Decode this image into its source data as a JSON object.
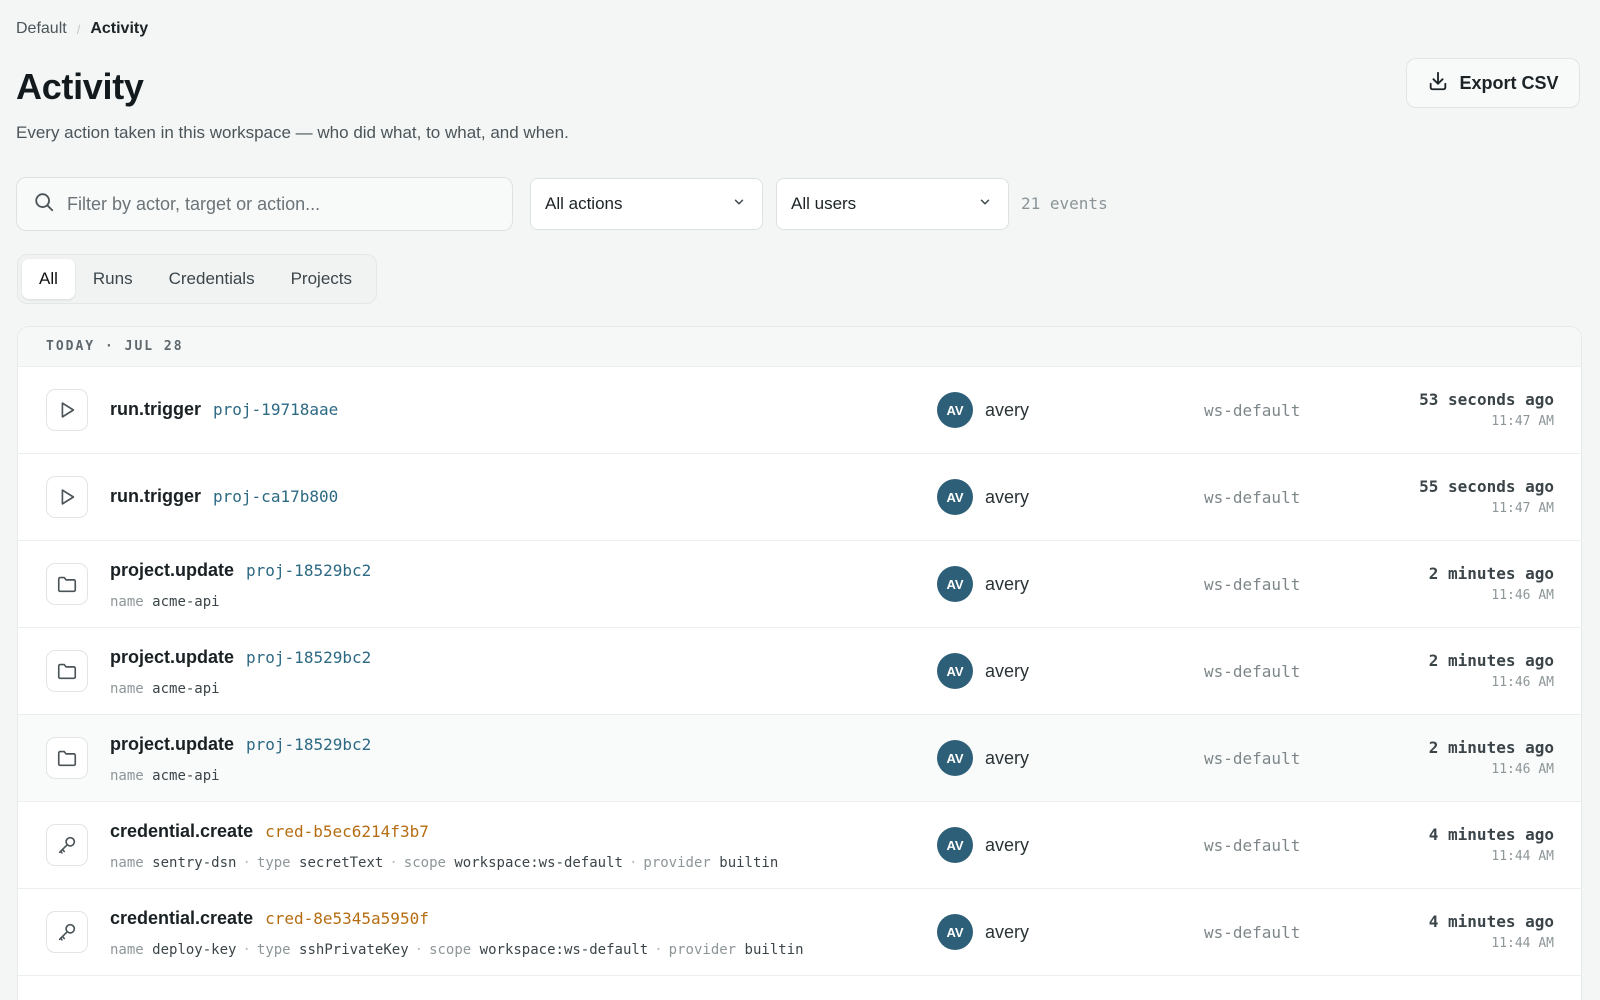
{
  "breadcrumb": {
    "parent": "Default",
    "separator": "/",
    "current": "Activity"
  },
  "page": {
    "title": "Activity",
    "subtitle": "Every action taken in this workspace — who did what, to what, and when."
  },
  "toolbar": {
    "export_label": "Export CSV"
  },
  "filters": {
    "search_placeholder": "Filter by actor, target or action...",
    "search_value": "",
    "action_select": "All actions",
    "user_select": "All users",
    "events_count": "21 events"
  },
  "tabs": [
    {
      "label": "All",
      "active": true
    },
    {
      "label": "Runs",
      "active": false
    },
    {
      "label": "Credentials",
      "active": false
    },
    {
      "label": "Projects",
      "active": false
    }
  ],
  "group": {
    "label": "TODAY · JUL 28"
  },
  "colors": {
    "avatar": "#2e5f78",
    "project_target": "#2c6983",
    "credential_target": "#b66d12"
  },
  "rows": [
    {
      "icon": "play-icon",
      "action": "run.trigger",
      "target": "proj-19718aae",
      "target_kind": "project",
      "meta": [],
      "actor_initials": "AV",
      "actor": "avery",
      "workspace": "ws-default",
      "relative_time": "53 seconds ago",
      "time": "11:47 AM"
    },
    {
      "icon": "play-icon",
      "action": "run.trigger",
      "target": "proj-ca17b800",
      "target_kind": "project",
      "meta": [],
      "actor_initials": "AV",
      "actor": "avery",
      "workspace": "ws-default",
      "relative_time": "55 seconds ago",
      "time": "11:47 AM"
    },
    {
      "icon": "folder-icon",
      "action": "project.update",
      "target": "proj-18529bc2",
      "target_kind": "project",
      "meta": [
        {
          "key": "name",
          "value": "acme-api"
        }
      ],
      "actor_initials": "AV",
      "actor": "avery",
      "workspace": "ws-default",
      "relative_time": "2 minutes ago",
      "time": "11:46 AM"
    },
    {
      "icon": "folder-icon",
      "action": "project.update",
      "target": "proj-18529bc2",
      "target_kind": "project",
      "meta": [
        {
          "key": "name",
          "value": "acme-api"
        }
      ],
      "actor_initials": "AV",
      "actor": "avery",
      "workspace": "ws-default",
      "relative_time": "2 minutes ago",
      "time": "11:46 AM"
    },
    {
      "icon": "folder-icon",
      "action": "project.update",
      "target": "proj-18529bc2",
      "target_kind": "project",
      "meta": [
        {
          "key": "name",
          "value": "acme-api"
        }
      ],
      "actor_initials": "AV",
      "actor": "avery",
      "workspace": "ws-default",
      "relative_time": "2 minutes ago",
      "time": "11:46 AM"
    },
    {
      "icon": "key-icon",
      "action": "credential.create",
      "target": "cred-b5ec6214f3b7",
      "target_kind": "cred",
      "meta": [
        {
          "key": "name",
          "value": "sentry-dsn"
        },
        {
          "key": "type",
          "value": "secretText"
        },
        {
          "key": "scope",
          "value": "workspace:ws-default"
        },
        {
          "key": "provider",
          "value": "builtin"
        }
      ],
      "actor_initials": "AV",
      "actor": "avery",
      "workspace": "ws-default",
      "relative_time": "4 minutes ago",
      "time": "11:44 AM"
    },
    {
      "icon": "key-icon",
      "action": "credential.create",
      "target": "cred-8e5345a5950f",
      "target_kind": "cred",
      "meta": [
        {
          "key": "name",
          "value": "deploy-key"
        },
        {
          "key": "type",
          "value": "sshPrivateKey"
        },
        {
          "key": "scope",
          "value": "workspace:ws-default"
        },
        {
          "key": "provider",
          "value": "builtin"
        }
      ],
      "actor_initials": "AV",
      "actor": "avery",
      "workspace": "ws-default",
      "relative_time": "4 minutes ago",
      "time": "11:44 AM"
    }
  ]
}
